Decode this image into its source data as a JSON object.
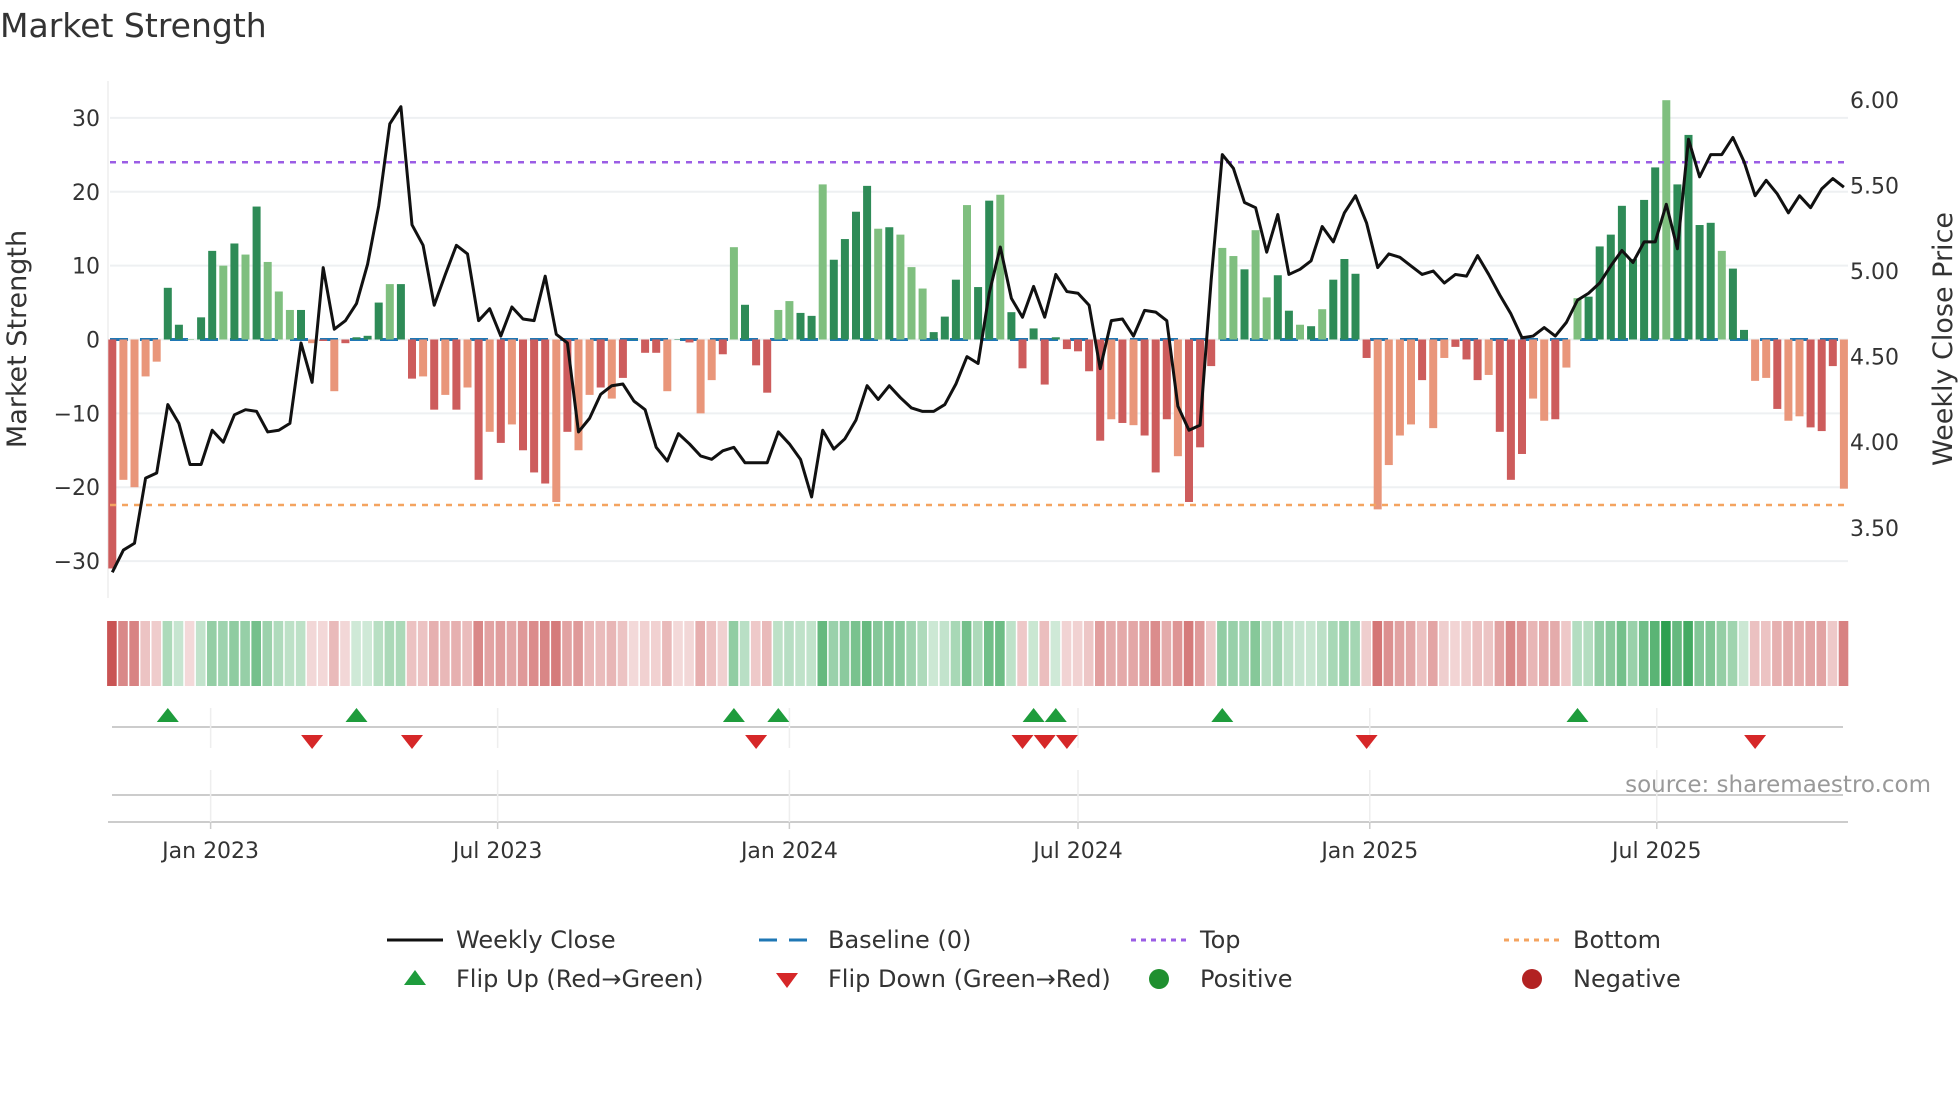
{
  "title": "Market Strength",
  "chart_data": {
    "type": "bar",
    "title": "Market Strength",
    "ylabel": "Market Strength",
    "y2label": "Weekly Close Price",
    "ylim": [
      -35,
      35
    ],
    "y2lim": [
      3.09,
      6.11
    ],
    "yticks": [
      "30",
      "20",
      "10",
      "0",
      "−10",
      "−20",
      "−30"
    ],
    "ytick_values": [
      30,
      20,
      10,
      0,
      -10,
      -20,
      -30
    ],
    "y2ticks": [
      "6.00",
      "5.50",
      "5.00",
      "4.50",
      "4.00",
      "3.50"
    ],
    "y2tick_values": [
      6.0,
      5.5,
      5.0,
      4.5,
      4.0,
      3.5
    ],
    "xticks": [
      {
        "label": "Jan 2023",
        "date": "2023-01-01"
      },
      {
        "label": "Jul 2023",
        "date": "2023-07-01"
      },
      {
        "label": "Jan 2024",
        "date": "2024-01-01"
      },
      {
        "label": "Jul 2024",
        "date": "2024-07-01"
      },
      {
        "label": "Jan 2025",
        "date": "2025-01-01"
      },
      {
        "label": "Jul 2025",
        "date": "2025-07-01"
      }
    ],
    "start_date": "2022-10-31",
    "frequency": "weekly",
    "top_level": 24,
    "bottom_level": -22.4,
    "baseline": 0,
    "strength": [
      -31,
      -19,
      -20,
      -5,
      -3,
      7,
      2,
      0,
      3,
      12,
      10,
      13,
      11.5,
      18,
      10.5,
      6.5,
      4,
      4,
      -0.5,
      -0.2,
      -7,
      -0.5,
      0.3,
      0.5,
      5,
      7.5,
      7.5,
      -5.3,
      -5,
      -9.5,
      -7.5,
      -9.5,
      -6.5,
      -19,
      -12.5,
      -14,
      -11.5,
      -15,
      -18,
      -19.5,
      -22,
      -12.5,
      -15,
      -7.5,
      -6.5,
      -8,
      -5.2,
      0,
      -1.8,
      -1.8,
      -7,
      0,
      -0.4,
      -10,
      -5.5,
      -2,
      12.5,
      4.7,
      -3.5,
      -7.2,
      4,
      5.2,
      3.6,
      3.2,
      21,
      10.8,
      13.6,
      17.3,
      20.8,
      15,
      15.2,
      14.2,
      9.8,
      6.9,
      1,
      3.1,
      8.1,
      18.2,
      7.1,
      18.8,
      19.6,
      3.7,
      -3.9,
      1.5,
      -6.1,
      0.3,
      -1.3,
      -1.6,
      -4.3,
      -13.7,
      -10.8,
      -11.3,
      -11.6,
      -13,
      -18,
      -10.8,
      -15.8,
      -22,
      -14.6,
      -3.6,
      12.4,
      11.3,
      9.5,
      14.8,
      5.7,
      8.7,
      3.9,
      2,
      1.8,
      4.1,
      8.1,
      10.9,
      8.9,
      -2.5,
      -23,
      -17,
      -13,
      -11.5,
      -5.5,
      -12,
      -2.5,
      -1,
      -2.7,
      -5.5,
      -4.8,
      -12.5,
      -19,
      -15.5,
      -8,
      -11,
      -10.8,
      -3.8,
      5.6,
      5.8,
      12.6,
      14.2,
      18.1,
      10.9,
      18.9,
      23.3,
      32.4,
      21,
      27.7,
      15.5,
      15.8,
      12,
      9.6,
      1.3,
      -5.6,
      -5.2,
      -9.4,
      -11,
      -10.4,
      -11.9,
      -12.4,
      -3.6,
      -20.2
    ],
    "strength_shade": "dllllddlddldldllldldlddddlddldldldldldddldlldlddddlddlldldddllddlddddldllldddlddldddddddddldldddldddlldllddldlddddlllldlldddldddlldlldddddddlddddlddlldlldddlddl",
    "weekly_close": [
      3.24,
      3.37,
      3.41,
      3.79,
      3.82,
      4.22,
      4.11,
      3.87,
      3.87,
      4.07,
      4.0,
      4.16,
      4.19,
      4.18,
      4.06,
      4.07,
      4.11,
      4.58,
      4.35,
      5.02,
      4.66,
      4.71,
      4.81,
      5.04,
      5.38,
      5.86,
      5.96,
      5.27,
      5.15,
      4.8,
      4.98,
      5.15,
      5.1,
      4.71,
      4.78,
      4.62,
      4.79,
      4.72,
      4.71,
      4.97,
      4.63,
      4.58,
      4.06,
      4.14,
      4.28,
      4.33,
      4.34,
      4.24,
      4.19,
      3.97,
      3.89,
      4.05,
      3.99,
      3.92,
      3.9,
      3.95,
      3.97,
      3.88,
      3.88,
      3.88,
      4.06,
      3.99,
      3.9,
      3.68,
      4.07,
      3.96,
      4.02,
      4.13,
      4.33,
      4.25,
      4.33,
      4.26,
      4.2,
      4.18,
      4.18,
      4.22,
      4.34,
      4.5,
      4.46,
      4.87,
      5.14,
      4.84,
      4.73,
      4.91,
      4.73,
      4.98,
      4.88,
      4.87,
      4.8,
      4.43,
      4.71,
      4.72,
      4.62,
      4.77,
      4.76,
      4.71,
      4.21,
      4.07,
      4.1,
      4.95,
      5.68,
      5.6,
      5.4,
      5.37,
      5.11,
      5.33,
      4.98,
      5.01,
      5.06,
      5.26,
      5.17,
      5.34,
      5.44,
      5.28,
      5.02,
      5.1,
      5.08,
      5.03,
      4.98,
      5.0,
      4.93,
      4.98,
      4.97,
      5.09,
      4.98,
      4.86,
      4.75,
      4.61,
      4.62,
      4.67,
      4.62,
      4.7,
      4.83,
      4.87,
      4.93,
      5.03,
      5.12,
      5.05,
      5.17,
      5.17,
      5.39,
      5.13,
      5.77,
      5.55,
      5.68,
      5.68,
      5.78,
      5.64,
      5.44,
      5.53,
      5.45,
      5.34,
      5.44,
      5.37,
      5.48,
      5.54,
      5.49
    ],
    "flip_up_weeks": [
      5,
      22,
      56,
      60,
      83,
      85,
      100,
      132
    ],
    "flip_down_weeks": [
      18,
      27,
      58,
      82,
      84,
      86,
      113,
      148
    ],
    "legend": [
      {
        "label": "Weekly Close",
        "kind": "line"
      },
      {
        "label": "Baseline (0)",
        "kind": "dash"
      },
      {
        "label": "Top",
        "kind": "dot-top"
      },
      {
        "label": "Bottom",
        "kind": "dot-bottom"
      },
      {
        "label": "Flip Up (Red→Green)",
        "kind": "tri-up"
      },
      {
        "label": "Flip Down (Green→Red)",
        "kind": "tri-down"
      },
      {
        "label": "Positive",
        "kind": "circle-pos"
      },
      {
        "label": "Negative",
        "kind": "circle-neg"
      }
    ],
    "legend_position": "bottom",
    "source": "source: sharemaestro.com"
  },
  "colors": {
    "strong_green": "#2e8b57",
    "weak_green": "#7fbf7f",
    "strong_red": "#cd5c5c",
    "weak_red": "#e9967a",
    "price": "#111111",
    "baseline": "#1f77b4",
    "top": "#9b5de5",
    "bottom": "#f4a460",
    "flip_up": "#1e9c3c",
    "flip_down": "#d62728",
    "positive": "#1f8f2f",
    "negative": "#b22222"
  }
}
